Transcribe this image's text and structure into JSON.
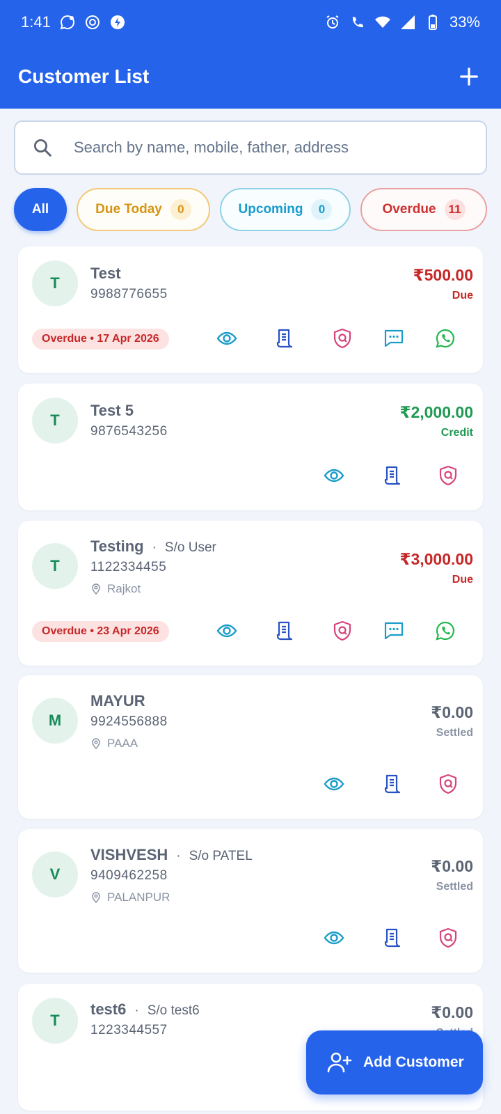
{
  "status_bar": {
    "time": "1:41",
    "battery": "33%"
  },
  "header": {
    "title": "Customer List"
  },
  "search": {
    "placeholder": "Search by name, mobile, father, address"
  },
  "filters": [
    {
      "label": "All"
    },
    {
      "label": "Due Today",
      "count": "0"
    },
    {
      "label": "Upcoming",
      "count": "0"
    },
    {
      "label": "Overdue",
      "count": "11"
    }
  ],
  "customers": [
    {
      "initial": "T",
      "name": "Test",
      "mobile": "9988776655",
      "amount": "₹500.00",
      "status": "Due",
      "badge": "Overdue • 17 Apr 2026"
    },
    {
      "initial": "T",
      "name": "Test 5",
      "mobile": "9876543256",
      "amount": "₹2,000.00",
      "status": "Credit"
    },
    {
      "initial": "T",
      "name": "Testing",
      "relation": "S/o User",
      "mobile": "1122334455",
      "address": "Rajkot",
      "amount": "₹3,000.00",
      "status": "Due",
      "badge": "Overdue • 23 Apr 2026"
    },
    {
      "initial": "M",
      "name": "MAYUR",
      "mobile": "9924556888",
      "address": "PAAA",
      "amount": "₹0.00",
      "status": "Settled"
    },
    {
      "initial": "V",
      "name": "VISHVESH",
      "relation": "S/o PATEL",
      "mobile": "9409462258",
      "address": "PALANPUR",
      "amount": "₹0.00",
      "status": "Settled"
    },
    {
      "initial": "T",
      "name": "test6",
      "relation": "S/o test6",
      "mobile": "1223344557",
      "amount": "₹0.00",
      "status": "Settled"
    }
  ],
  "fab": {
    "label": "Add Customer"
  },
  "icons": {
    "view": "eye-icon",
    "ledger": "receipt-icon",
    "guarantee": "shield-icon",
    "sms": "message-icon",
    "whatsapp": "whatsapp-icon",
    "add": "plus-icon",
    "search": "search-icon",
    "location": "location-pin-icon",
    "add_customer": "user-plus-icon"
  },
  "colors": {
    "primary": "#2563eb",
    "due": "#c62828",
    "credit": "#1f9a52",
    "settled": "#5b6474",
    "eye": "#1a9cc9",
    "ledger": "#2852c4",
    "shield": "#d6457c",
    "sms": "#1a9cc9",
    "whatsapp": "#22b84c"
  }
}
